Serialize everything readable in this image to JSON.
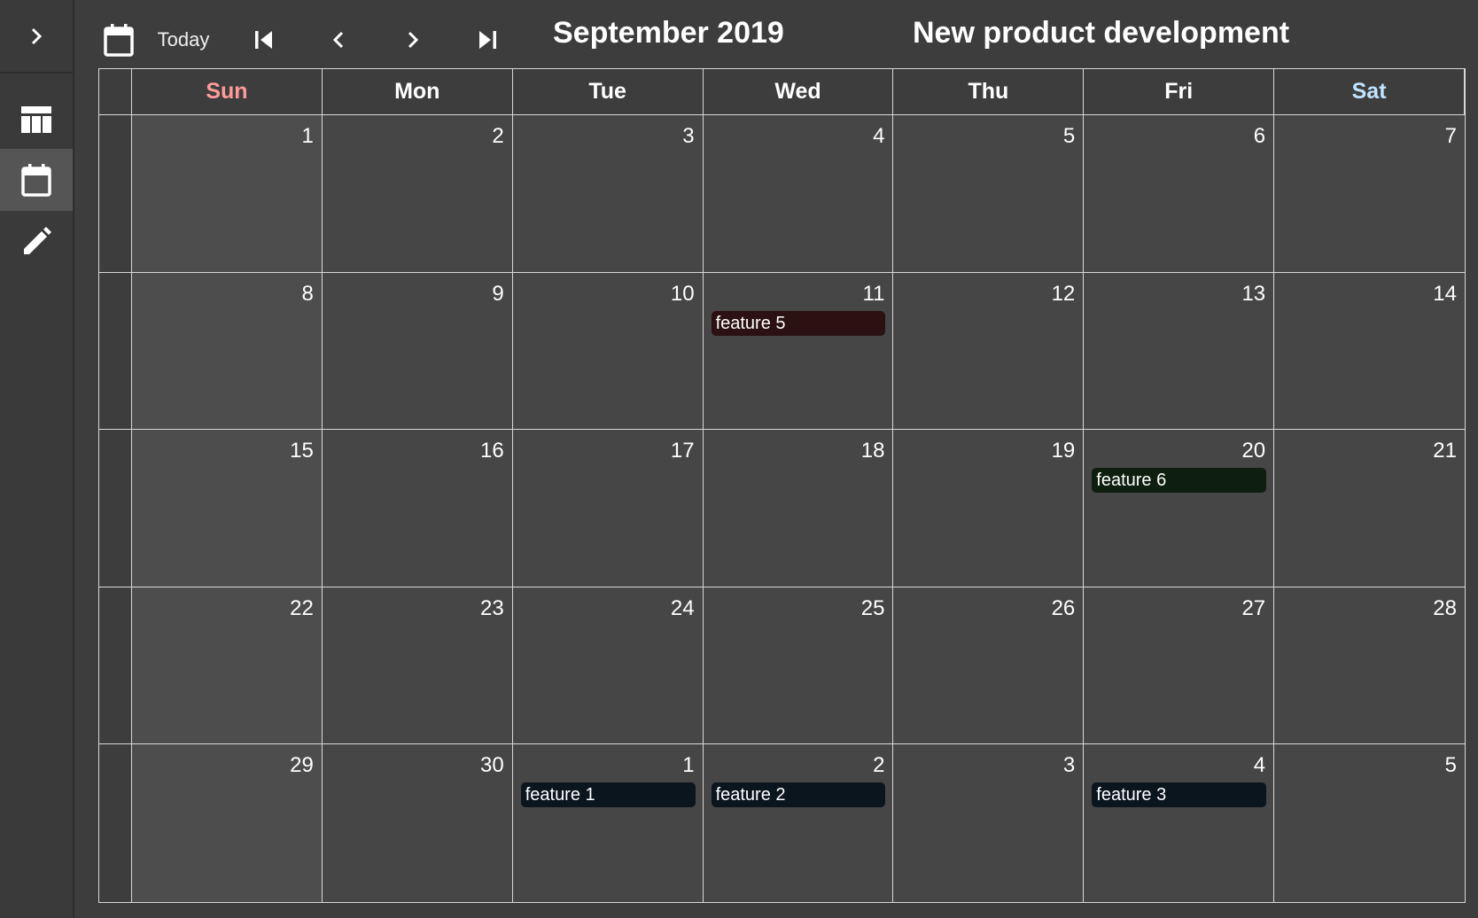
{
  "toolbar": {
    "today_label": "Today",
    "month_title": "September 2019",
    "project_title": "New product development"
  },
  "colors": {
    "sunday_header": "#ff9a9a",
    "saturday_header": "#bfe3ff",
    "weekday_header": "#ffffff",
    "event_dark_red": "#2b1111",
    "event_dark_green": "#0f1f0f",
    "event_dark_blue": "#0b151e"
  },
  "weekdays": [
    "Sun",
    "Mon",
    "Tue",
    "Wed",
    "Thu",
    "Fri",
    "Sat"
  ],
  "weeks": [
    [
      "1",
      "2",
      "3",
      "4",
      "5",
      "6",
      "7"
    ],
    [
      "8",
      "9",
      "10",
      "11",
      "12",
      "13",
      "14"
    ],
    [
      "15",
      "16",
      "17",
      "18",
      "19",
      "20",
      "21"
    ],
    [
      "22",
      "23",
      "24",
      "25",
      "26",
      "27",
      "28"
    ],
    [
      "29",
      "30",
      "1",
      "2",
      "3",
      "4",
      "5"
    ]
  ],
  "events": [
    {
      "label": "feature 5",
      "week": 1,
      "day": 3,
      "color": "#2b1111"
    },
    {
      "label": "feature 6",
      "week": 2,
      "day": 5,
      "color": "#0f1f0f"
    },
    {
      "label": "feature 1",
      "week": 4,
      "day": 2,
      "color": "#0b151e"
    },
    {
      "label": "feature 2",
      "week": 4,
      "day": 3,
      "color": "#0b151e"
    },
    {
      "label": "feature 3",
      "week": 4,
      "day": 5,
      "color": "#0b151e"
    }
  ],
  "sidebar": {
    "items": [
      {
        "icon": "chevron-right-icon"
      },
      {
        "icon": "table-icon"
      },
      {
        "icon": "calendar-icon",
        "active": true
      },
      {
        "icon": "pencil-icon"
      }
    ]
  }
}
